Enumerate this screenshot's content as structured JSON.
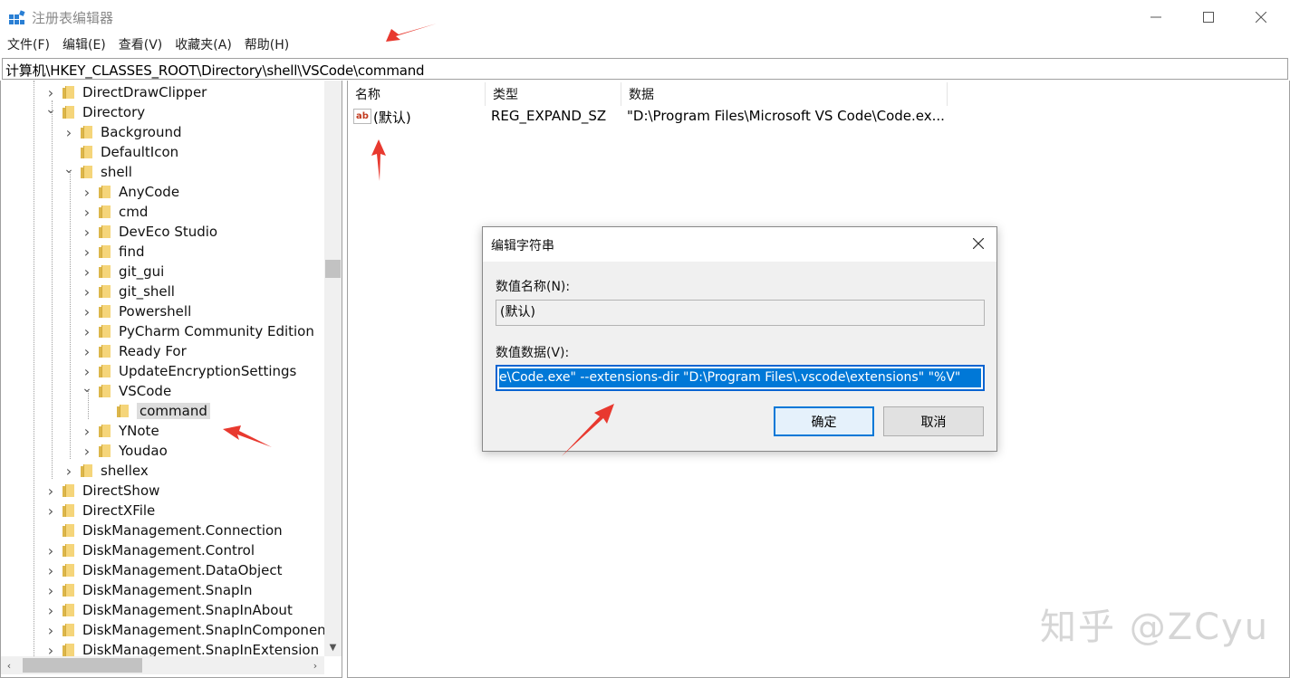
{
  "window": {
    "title": "注册表编辑器",
    "min_icon": "minimize-icon",
    "max_icon": "maximize-icon",
    "close_icon": "close-icon"
  },
  "menu": [
    "文件(F)",
    "编辑(E)",
    "查看(V)",
    "收藏夹(A)",
    "帮助(H)"
  ],
  "address": "计算机\\HKEY_CLASSES_ROOT\\Directory\\shell\\VSCode\\command",
  "tree": [
    {
      "label": "DirectDrawClipper",
      "level": 0,
      "exp": "collapsed"
    },
    {
      "label": "Directory",
      "level": 0,
      "exp": "expanded"
    },
    {
      "label": "Background",
      "level": 1,
      "exp": "collapsed"
    },
    {
      "label": "DefaultIcon",
      "level": 1,
      "exp": "none"
    },
    {
      "label": "shell",
      "level": 1,
      "exp": "expanded"
    },
    {
      "label": "AnyCode",
      "level": 2,
      "exp": "collapsed"
    },
    {
      "label": "cmd",
      "level": 2,
      "exp": "collapsed"
    },
    {
      "label": "DevEco Studio",
      "level": 2,
      "exp": "collapsed"
    },
    {
      "label": "find",
      "level": 2,
      "exp": "collapsed"
    },
    {
      "label": "git_gui",
      "level": 2,
      "exp": "collapsed"
    },
    {
      "label": "git_shell",
      "level": 2,
      "exp": "collapsed"
    },
    {
      "label": "Powershell",
      "level": 2,
      "exp": "collapsed"
    },
    {
      "label": "PyCharm Community Edition",
      "level": 2,
      "exp": "collapsed"
    },
    {
      "label": "Ready For",
      "level": 2,
      "exp": "collapsed"
    },
    {
      "label": "UpdateEncryptionSettings",
      "level": 2,
      "exp": "collapsed"
    },
    {
      "label": "VSCode",
      "level": 2,
      "exp": "expanded"
    },
    {
      "label": "command",
      "level": 3,
      "exp": "none",
      "selected": true
    },
    {
      "label": "YNote",
      "level": 2,
      "exp": "collapsed"
    },
    {
      "label": "Youdao",
      "level": 2,
      "exp": "collapsed"
    },
    {
      "label": "shellex",
      "level": 1,
      "exp": "collapsed"
    },
    {
      "label": "DirectShow",
      "level": 0,
      "exp": "collapsed"
    },
    {
      "label": "DirectXFile",
      "level": 0,
      "exp": "collapsed"
    },
    {
      "label": "DiskManagement.Connection",
      "level": 0,
      "exp": "none"
    },
    {
      "label": "DiskManagement.Control",
      "level": 0,
      "exp": "collapsed"
    },
    {
      "label": "DiskManagement.DataObject",
      "level": 0,
      "exp": "collapsed"
    },
    {
      "label": "DiskManagement.SnapIn",
      "level": 0,
      "exp": "collapsed"
    },
    {
      "label": "DiskManagement.SnapInAbout",
      "level": 0,
      "exp": "collapsed"
    },
    {
      "label": "DiskManagement.SnapInComponent",
      "level": 0,
      "exp": "collapsed"
    },
    {
      "label": "DiskManagement.SnapInExtension",
      "level": 0,
      "exp": "collapsed"
    }
  ],
  "values": {
    "columns": [
      "名称",
      "类型",
      "数据"
    ],
    "rows": [
      {
        "name": "(默认)",
        "type": "REG_EXPAND_SZ",
        "data": "\"D:\\Program Files\\Microsoft VS Code\\Code.ex...",
        "icon": "ab"
      }
    ]
  },
  "dialog": {
    "title": "编辑字符串",
    "name_label": "数值名称(N):",
    "name_value": "(默认)",
    "data_label": "数值数据(V):",
    "data_value": "e\\Code.exe\" --extensions-dir \"D:\\Program Files\\.vscode\\extensions\" \"%V\"",
    "ok_label": "确定",
    "cancel_label": "取消"
  },
  "watermark": "知乎 @ZCyu",
  "colors": {
    "accent": "#0078d7",
    "arrow": "#e8392f",
    "folder": "#f5d57a"
  }
}
